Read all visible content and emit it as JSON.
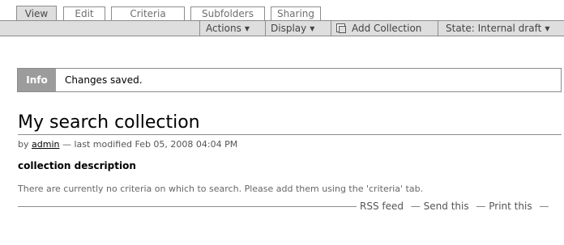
{
  "tabs": [
    {
      "label": "View",
      "selected": true
    },
    {
      "label": "Edit",
      "selected": false
    },
    {
      "label": "Criteria",
      "selected": false
    },
    {
      "label": "Subfolders",
      "selected": false
    },
    {
      "label": "Sharing",
      "selected": false
    }
  ],
  "actionbar": {
    "actions": "Actions",
    "display": "Display",
    "add_collection": "Add Collection",
    "state": "State: Internal draft",
    "dropdown_arrow": "▼",
    "add_icon": "document-copy-icon"
  },
  "info": {
    "tag": "Info",
    "message": "Changes saved."
  },
  "content": {
    "title": "My search collection",
    "byline_prefix": "by",
    "author": "admin",
    "byline_suffix": "— last modified Feb 05, 2008 04:04 PM",
    "description": "collection description",
    "note": "There are currently no criteria on which to search. Please add them using the 'criteria' tab."
  },
  "footer": {
    "rss": "RSS feed",
    "send": "Send this",
    "print": "Print this",
    "dash": "—"
  },
  "colors": {
    "bar_background": "#dedede",
    "border": "#8c8c8c",
    "info_tag": "#9c9c9c"
  }
}
